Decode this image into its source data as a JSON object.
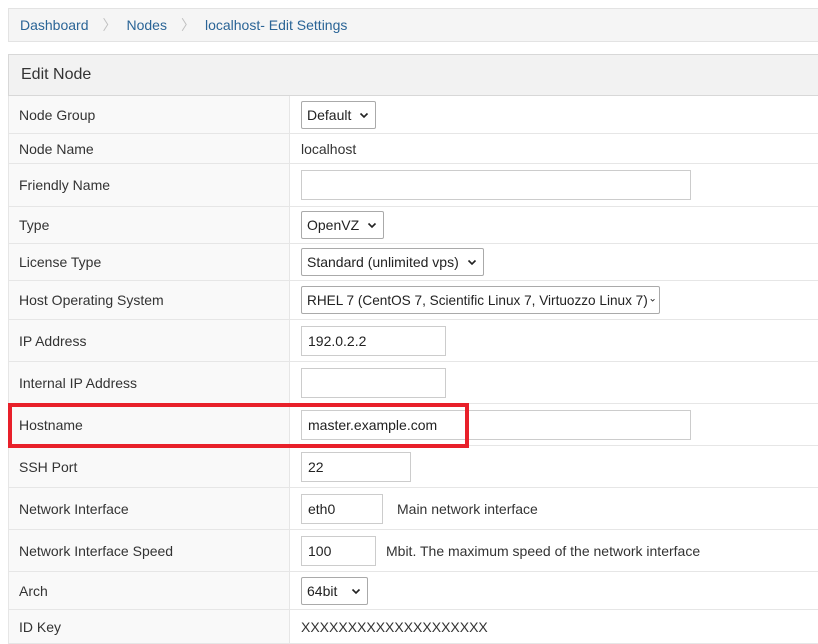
{
  "breadcrumb": {
    "items": [
      "Dashboard",
      "Nodes",
      "localhost- Edit Settings"
    ]
  },
  "panel": {
    "title": "Edit Node"
  },
  "form": {
    "node_group": {
      "label": "Node Group",
      "selected": "Default"
    },
    "node_name": {
      "label": "Node Name",
      "value": "localhost"
    },
    "friendly_name": {
      "label": "Friendly Name",
      "value": ""
    },
    "type": {
      "label": "Type",
      "selected": "OpenVZ"
    },
    "license_type": {
      "label": "License Type",
      "selected": "Standard (unlimited vps)"
    },
    "host_os": {
      "label": "Host Operating System",
      "selected": "RHEL 7 (CentOS 7, Scientific Linux 7, Virtuozzo Linux 7)"
    },
    "ip_address": {
      "label": "IP Address",
      "value": "192.0.2.2"
    },
    "internal_ip": {
      "label": "Internal IP Address",
      "value": ""
    },
    "hostname": {
      "label": "Hostname",
      "value": "master.example.com"
    },
    "ssh_port": {
      "label": "SSH Port",
      "value": "22"
    },
    "network_interface": {
      "label": "Network Interface",
      "value": "eth0",
      "hint": "Main network interface"
    },
    "network_speed": {
      "label": "Network Interface Speed",
      "value": "100",
      "hint": "Mbit. The maximum speed of the network interface"
    },
    "arch": {
      "label": "Arch",
      "selected": "64bit"
    },
    "id_key": {
      "label": "ID Key",
      "value": "XXXXXXXXXXXXXXXXXXXX"
    }
  },
  "colors": {
    "link": "#2a6496",
    "highlight": "#e8202a",
    "label_bg": "#f9f9f9",
    "heading_bg": "#f2f2f2"
  }
}
